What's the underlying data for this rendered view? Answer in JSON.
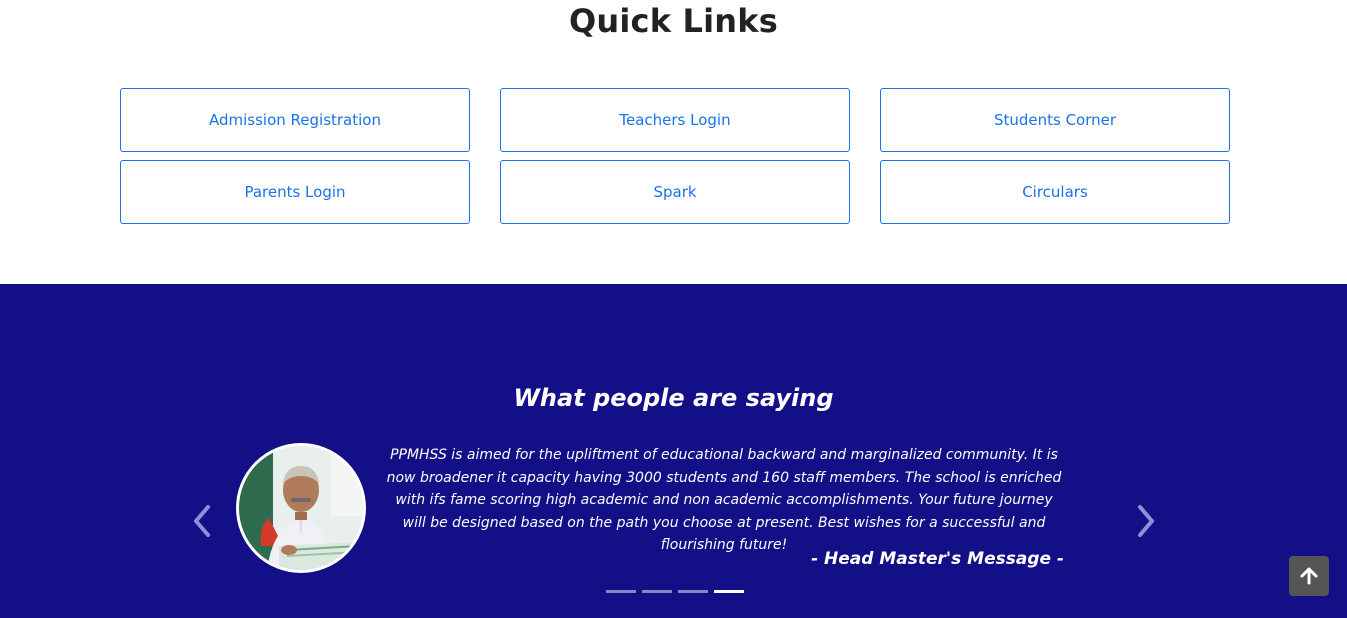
{
  "quick_links": {
    "title": "Quick Links",
    "items": [
      {
        "label": "Admission Registration"
      },
      {
        "label": "Teachers Login"
      },
      {
        "label": "Students Corner"
      },
      {
        "label": "Parents Login"
      },
      {
        "label": "Spark"
      },
      {
        "label": "Circulars"
      }
    ]
  },
  "testimonials": {
    "title": "What people are saying",
    "quote": "PPMHSS is aimed for the upliftment of educational backward and marginalized community. It is now broadener it capacity having 3000 students and 160 staff members. The school is enriched with ifs fame scoring high academic and non academic accomplishments. Your future journey will be designed based on the path you choose at present. Best wishes for a successful and flourishing future!",
    "author": "- Head Master's Message -",
    "prev_icon": "chevron-left-icon",
    "next_icon": "chevron-right-icon",
    "slide_count": 4,
    "active_slide": 4
  },
  "scroll_top": {
    "icon": "arrow-up-icon"
  },
  "colors": {
    "accent": "#1a73e8",
    "band_background": "#130f87",
    "scroll_button": "#555555"
  }
}
